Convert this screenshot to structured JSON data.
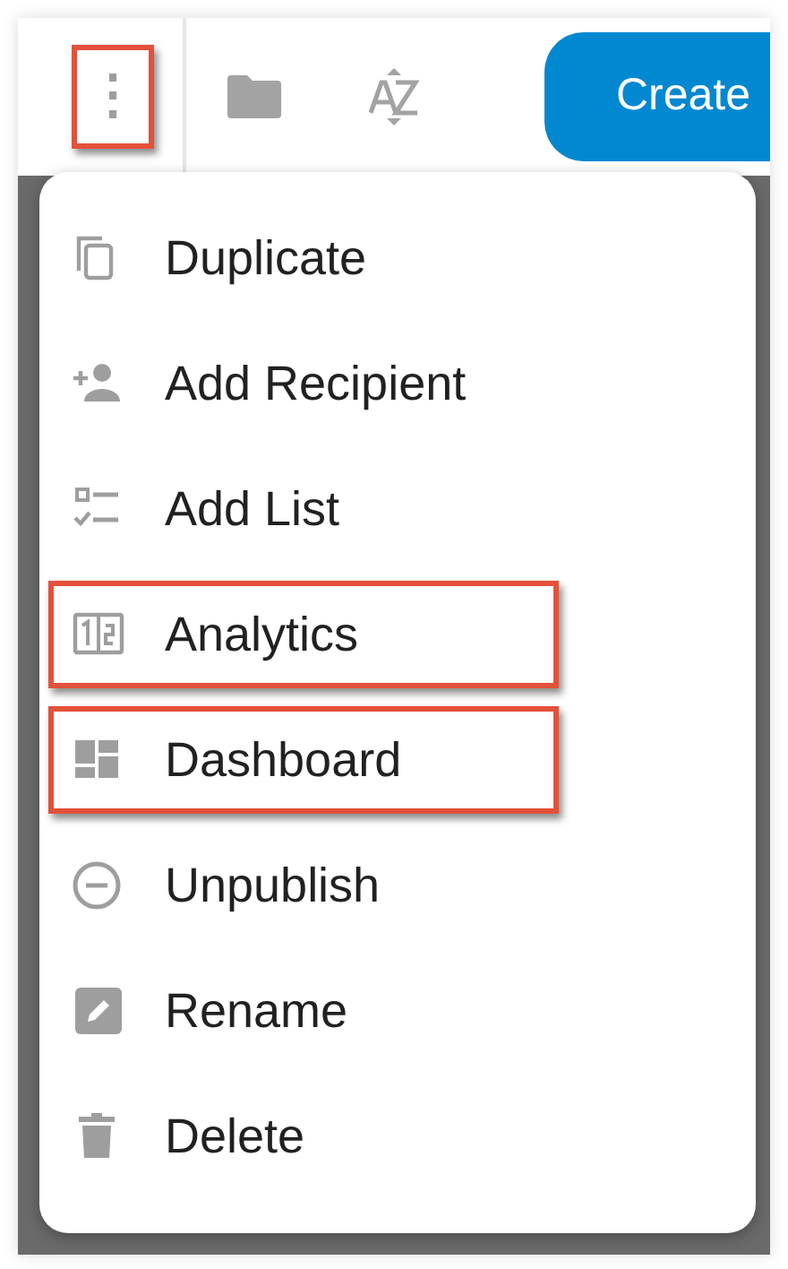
{
  "toolbar": {
    "more_button": {
      "label": "⋮",
      "highlighted": true
    },
    "create_button": {
      "label": "Create"
    }
  },
  "menu": {
    "items": [
      {
        "kind": "duplicate",
        "label": "Duplicate",
        "highlighted": false
      },
      {
        "kind": "add-recipient",
        "label": "Add Recipient",
        "highlighted": false
      },
      {
        "kind": "add-list",
        "label": "Add List",
        "highlighted": false
      },
      {
        "kind": "analytics",
        "label": "Analytics",
        "highlighted": true
      },
      {
        "kind": "dashboard",
        "label": "Dashboard",
        "highlighted": true
      },
      {
        "kind": "unpublish",
        "label": "Unpublish",
        "highlighted": false
      },
      {
        "kind": "rename",
        "label": "Rename",
        "highlighted": false
      },
      {
        "kind": "delete",
        "label": "Delete",
        "highlighted": false
      }
    ]
  }
}
